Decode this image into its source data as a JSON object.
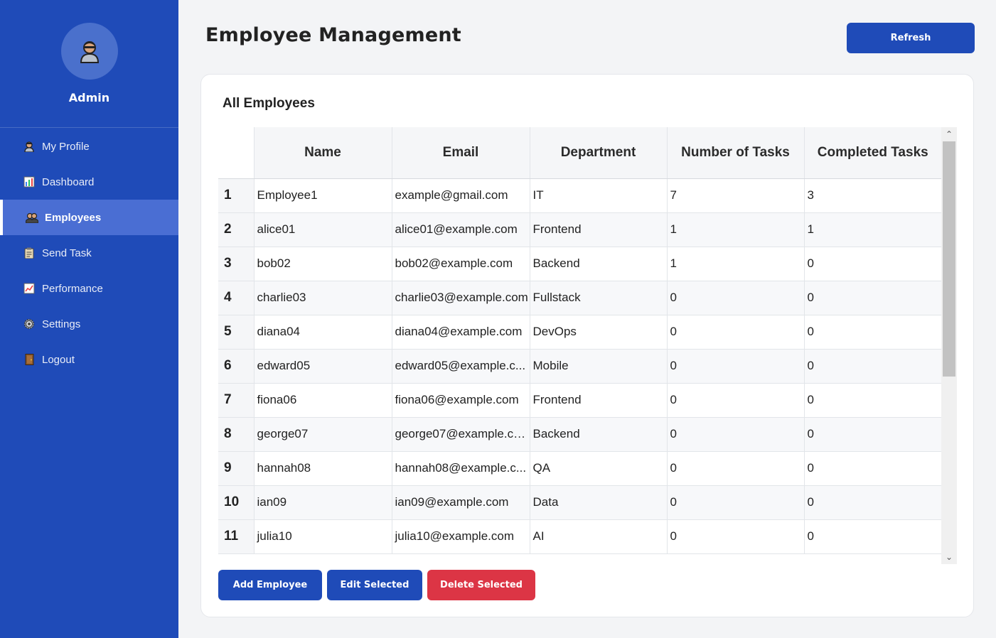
{
  "sidebar": {
    "user_name": "Admin",
    "items": [
      {
        "label": "My Profile",
        "icon": "profile-icon"
      },
      {
        "label": "Dashboard",
        "icon": "chart-icon"
      },
      {
        "label": "Employees",
        "icon": "employees-icon",
        "active": true
      },
      {
        "label": "Send Task",
        "icon": "clipboard-icon"
      },
      {
        "label": "Performance",
        "icon": "trend-icon"
      },
      {
        "label": "Settings",
        "icon": "gear-icon"
      },
      {
        "label": "Logout",
        "icon": "door-icon"
      }
    ]
  },
  "header": {
    "title": "Employee Management",
    "refresh_label": "Refresh"
  },
  "card": {
    "title": "All Employees"
  },
  "table": {
    "columns": [
      "Name",
      "Email",
      "Department",
      "Number of Tasks",
      "Completed Tasks"
    ],
    "rows": [
      {
        "idx": "1",
        "name": "Employee1",
        "email": "example@gmail.com",
        "dept": "IT",
        "tasks": "7",
        "completed": "3"
      },
      {
        "idx": "2",
        "name": "alice01",
        "email": "alice01@example.com",
        "dept": "Frontend",
        "tasks": "1",
        "completed": "1"
      },
      {
        "idx": "3",
        "name": "bob02",
        "email": "bob02@example.com",
        "dept": "Backend",
        "tasks": "1",
        "completed": "0"
      },
      {
        "idx": "4",
        "name": "charlie03",
        "email": "charlie03@example.com",
        "dept": "Fullstack",
        "tasks": "0",
        "completed": "0"
      },
      {
        "idx": "5",
        "name": "diana04",
        "email": "diana04@example.com",
        "dept": "DevOps",
        "tasks": "0",
        "completed": "0"
      },
      {
        "idx": "6",
        "name": "edward05",
        "email": "edward05@example.c...",
        "dept": "Mobile",
        "tasks": "0",
        "completed": "0"
      },
      {
        "idx": "7",
        "name": "fiona06",
        "email": "fiona06@example.com",
        "dept": "Frontend",
        "tasks": "0",
        "completed": "0"
      },
      {
        "idx": "8",
        "name": "george07",
        "email": "george07@example.co...",
        "dept": "Backend",
        "tasks": "0",
        "completed": "0"
      },
      {
        "idx": "9",
        "name": "hannah08",
        "email": "hannah08@example.c...",
        "dept": "QA",
        "tasks": "0",
        "completed": "0"
      },
      {
        "idx": "10",
        "name": "ian09",
        "email": "ian09@example.com",
        "dept": "Data",
        "tasks": "0",
        "completed": "0"
      },
      {
        "idx": "11",
        "name": "julia10",
        "email": "julia10@example.com",
        "dept": "AI",
        "tasks": "0",
        "completed": "0"
      }
    ]
  },
  "actions": {
    "add_label": "Add Employee",
    "edit_label": "Edit Selected",
    "delete_label": "Delete Selected"
  },
  "colors": {
    "sidebar": "#1f4bb8",
    "active_item": "#4a6ed3",
    "primary_button": "#1f4bb8",
    "danger_button": "#dc3545"
  }
}
